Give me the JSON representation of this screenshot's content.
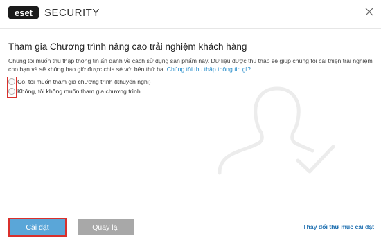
{
  "app": {
    "logo_text": "eset",
    "product_name": "SECURITY"
  },
  "main": {
    "heading": "Tham gia Chương trình nâng cao trải nghiệm khách hàng",
    "description": "Chúng tôi muốn thu thập thông tin ẩn danh về cách sử dụng sản phẩm này. Dữ liệu được thu thập sẽ giúp chúng tôi cải thiện trải nghiệm cho bạn và sẽ không bao giờ được chia sẻ với bên thứ ba.",
    "info_link": "Chúng tôi thu thập thông tin gì?",
    "options": [
      {
        "label": "Có, tôi muốn tham gia chương trình (khuyến nghị)",
        "selected": false
      },
      {
        "label": "Không, tôi không muốn tham gia chương trình",
        "selected": false
      }
    ]
  },
  "footer": {
    "install_label": "Cài đặt",
    "back_label": "Quay lại",
    "change_folder_label": "Thay đổi thư mục cài đặt"
  },
  "colors": {
    "accent": "#5aa6d8",
    "highlight": "#d9302c",
    "link": "#1e88c8"
  }
}
